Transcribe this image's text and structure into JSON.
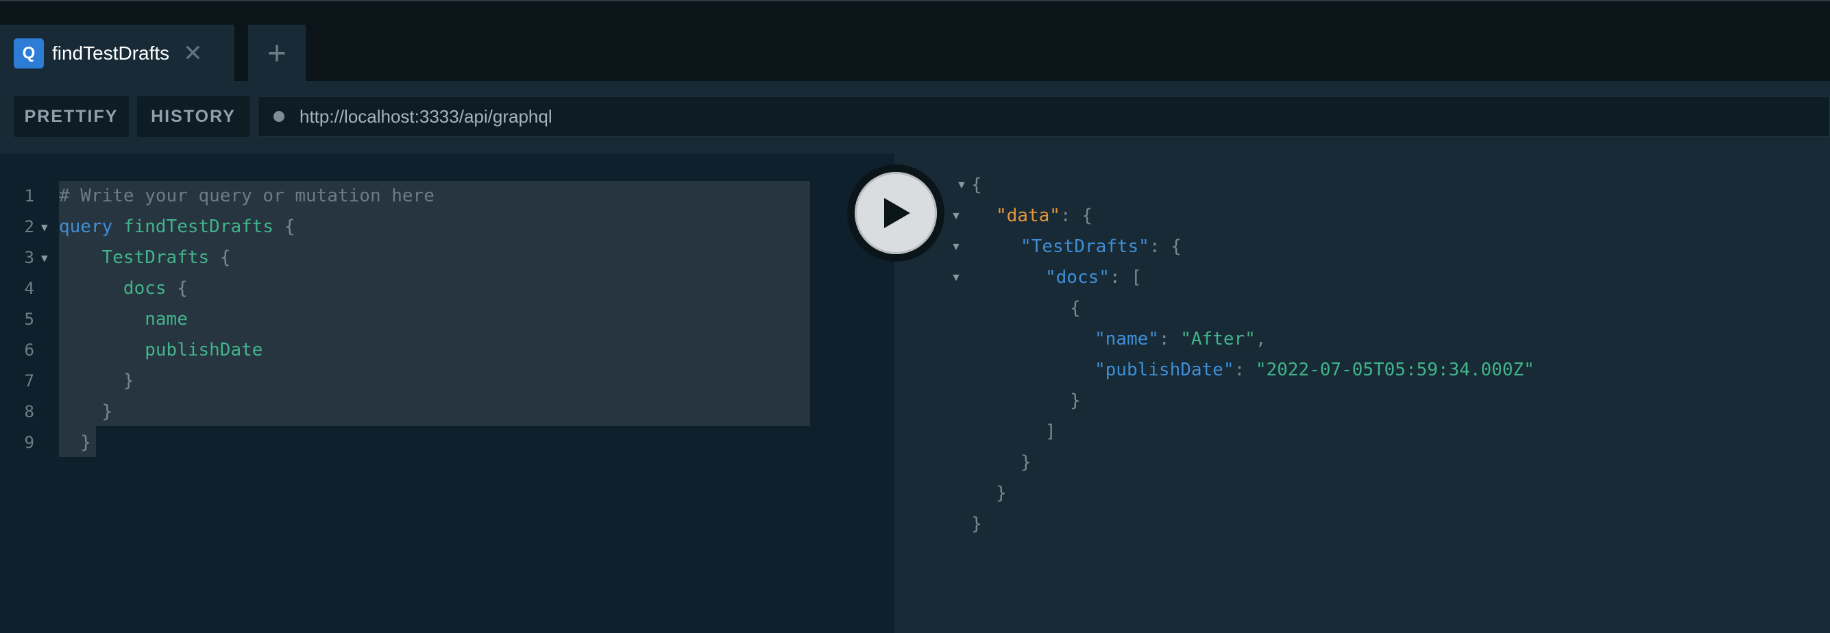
{
  "tabs": [
    {
      "badge": "Q",
      "title": "findTestDrafts",
      "close_glyph": "✕"
    }
  ],
  "new_tab_glyph": "+",
  "toolbar": {
    "prettify_label": "PRETTIFY",
    "history_label": "HISTORY",
    "endpoint_url": "http://localhost:3333/api/graphql"
  },
  "editor": {
    "lines": [
      {
        "num": "1",
        "tokens": [
          {
            "t": "# Write your query or mutation here",
            "c": "c-comment"
          }
        ]
      },
      {
        "num": "2",
        "fold": "▼",
        "tokens": [
          {
            "t": "query",
            "c": "c-kw"
          },
          {
            "t": " "
          },
          {
            "t": "findTestDrafts",
            "c": "c-name"
          },
          {
            "t": " "
          },
          {
            "t": "{",
            "c": "c-punct"
          }
        ]
      },
      {
        "num": "3",
        "fold": "▼",
        "tokens": [
          {
            "t": "    "
          },
          {
            "t": "TestDrafts",
            "c": "c-field"
          },
          {
            "t": " "
          },
          {
            "t": "{",
            "c": "c-punct"
          }
        ]
      },
      {
        "num": "4",
        "tokens": [
          {
            "t": "      "
          },
          {
            "t": "docs",
            "c": "c-field"
          },
          {
            "t": " "
          },
          {
            "t": "{",
            "c": "c-punct"
          }
        ]
      },
      {
        "num": "5",
        "tokens": [
          {
            "t": "        "
          },
          {
            "t": "name",
            "c": "c-field"
          }
        ]
      },
      {
        "num": "6",
        "tokens": [
          {
            "t": "        "
          },
          {
            "t": "publishDate",
            "c": "c-field"
          }
        ]
      },
      {
        "num": "7",
        "tokens": [
          {
            "t": "      "
          },
          {
            "t": "}",
            "c": "c-punct"
          }
        ]
      },
      {
        "num": "8",
        "tokens": [
          {
            "t": "    "
          },
          {
            "t": "}",
            "c": "c-punct"
          }
        ]
      },
      {
        "num": "9",
        "tokens": [
          {
            "t": "  "
          },
          {
            "t": "}",
            "c": "c-punct"
          }
        ]
      }
    ]
  },
  "result": {
    "lines": [
      {
        "fold": "▼",
        "indent": 0,
        "tokens": [
          {
            "t": "{",
            "c": "r-punct"
          }
        ]
      },
      {
        "fold": "▼",
        "indent": 1,
        "tokens": [
          {
            "t": "\"data\"",
            "c": "r-key-data"
          },
          {
            "t": ": ",
            "c": "r-punct"
          },
          {
            "t": "{",
            "c": "r-punct"
          }
        ]
      },
      {
        "fold": "▼",
        "indent": 2,
        "tokens": [
          {
            "t": "\"TestDrafts\"",
            "c": "r-key"
          },
          {
            "t": ": ",
            "c": "r-punct"
          },
          {
            "t": "{",
            "c": "r-punct"
          }
        ]
      },
      {
        "fold": "▼",
        "indent": 3,
        "tokens": [
          {
            "t": "\"docs\"",
            "c": "r-key"
          },
          {
            "t": ": ",
            "c": "r-punct"
          },
          {
            "t": "[",
            "c": "r-punct"
          }
        ]
      },
      {
        "indent": 4,
        "tokens": [
          {
            "t": "{",
            "c": "r-punct"
          }
        ]
      },
      {
        "indent": 5,
        "tokens": [
          {
            "t": "\"name\"",
            "c": "r-key"
          },
          {
            "t": ": ",
            "c": "r-punct"
          },
          {
            "t": "\"After\"",
            "c": "r-str"
          },
          {
            "t": ",",
            "c": "r-punct"
          }
        ]
      },
      {
        "indent": 5,
        "tokens": [
          {
            "t": "\"publishDate\"",
            "c": "r-key"
          },
          {
            "t": ": ",
            "c": "r-punct"
          },
          {
            "t": "\"2022-07-05T05:59:34.000Z\"",
            "c": "r-str"
          }
        ]
      },
      {
        "indent": 4,
        "tokens": [
          {
            "t": "}",
            "c": "r-punct"
          }
        ]
      },
      {
        "indent": 3,
        "tokens": [
          {
            "t": "]",
            "c": "r-punct"
          }
        ]
      },
      {
        "indent": 2,
        "tokens": [
          {
            "t": "}",
            "c": "r-punct"
          }
        ]
      },
      {
        "indent": 1,
        "tokens": [
          {
            "t": "}",
            "c": "r-punct"
          }
        ]
      },
      {
        "indent": 0,
        "tokens": [
          {
            "t": "}",
            "c": "r-punct"
          }
        ]
      }
    ]
  },
  "icons": {
    "run": "play-icon",
    "url_status": "status-dot-icon",
    "add_tab": "plus-icon",
    "close_tab": "close-icon"
  },
  "colors": {
    "badge": "#2d7cd6",
    "keyword": "#3f8ed6",
    "field": "#42b38a",
    "data_key": "#e8953a",
    "panel_bg": "#172a35",
    "editor_bg": "#0f202d"
  }
}
